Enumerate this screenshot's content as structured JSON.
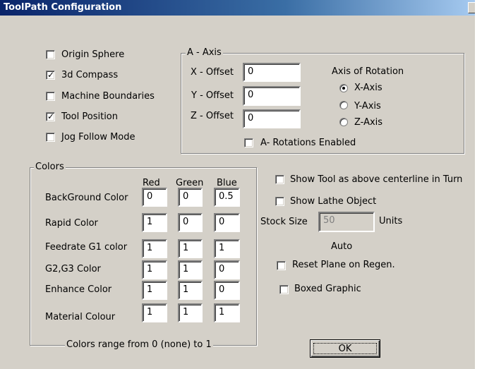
{
  "window": {
    "title": "ToolPath Configuration"
  },
  "display_options": [
    {
      "label": "Origin Sphere",
      "checked": false
    },
    {
      "label": "3d Compass",
      "checked": true
    },
    {
      "label": "Machine Boundaries",
      "checked": false
    },
    {
      "label": "Tool Position",
      "checked": true
    },
    {
      "label": "Jog Follow Mode",
      "checked": false
    }
  ],
  "a_axis": {
    "title": "A - Axis",
    "x_offset_label": "X - Offset",
    "x_offset_value": "0",
    "y_offset_label": "Y - Offset",
    "y_offset_value": "0",
    "z_offset_label": "Z - Offset",
    "z_offset_value": "0",
    "rotation_title": "Axis of Rotation",
    "rotation_options": [
      {
        "label": "X-Axis",
        "selected": true
      },
      {
        "label": "Y-Axis",
        "selected": false
      },
      {
        "label": "Z-Axis",
        "selected": false
      }
    ],
    "rotations_enabled_label": "A- Rotations Enabled",
    "rotations_enabled": false
  },
  "colors": {
    "title": "Colors",
    "headers": [
      "Red",
      "Green",
      "Blue"
    ],
    "rows": [
      {
        "label": "BackGround Color",
        "values": [
          "0",
          "0",
          "0.5"
        ]
      },
      {
        "label": "Rapid Color",
        "values": [
          "1",
          "0",
          "0"
        ]
      },
      {
        "label": "Feedrate G1 color",
        "values": [
          "1",
          "1",
          "1"
        ]
      },
      {
        "label": "G2,G3 Color",
        "values": [
          "1",
          "1",
          "0"
        ]
      },
      {
        "label": "Enhance Color",
        "values": [
          "1",
          "1",
          "0"
        ]
      },
      {
        "label": "Material Colour",
        "values": [
          "1",
          "1",
          "1"
        ]
      }
    ],
    "footer": "Colors range from 0 (none) to 1"
  },
  "lathe": {
    "show_tool_label": "Show Tool as above centerline in Turn",
    "show_tool_checked": false,
    "show_lathe_label": "Show Lathe Object",
    "show_lathe_checked": false,
    "stock_size_label": "Stock Size",
    "stock_size_value": "50",
    "units_label": "Units",
    "auto_label": "Auto",
    "reset_plane_label": "Reset Plane on Regen.",
    "reset_plane_checked": false,
    "boxed_graphic_label": "Boxed Graphic",
    "boxed_graphic_checked": false
  },
  "buttons": {
    "ok_label": "OK"
  }
}
